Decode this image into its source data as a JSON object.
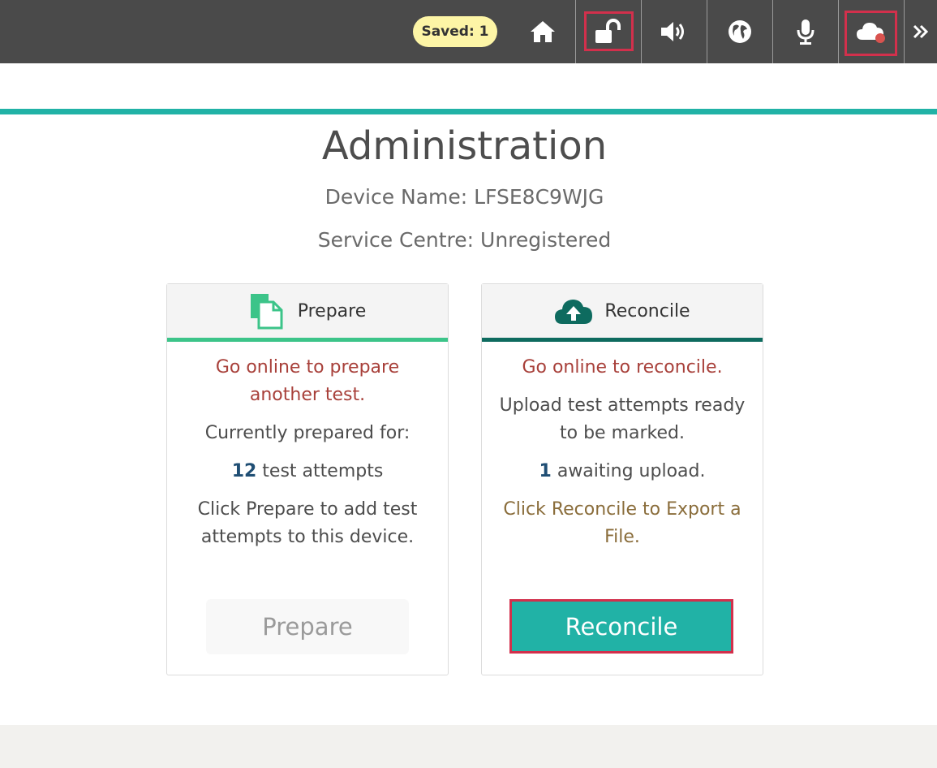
{
  "toolbar": {
    "saved_label": "Saved: 1",
    "icons": [
      "home-icon",
      "unlock-icon",
      "speaker-icon",
      "globe-icon",
      "microphone-icon",
      "cloud-offline-icon",
      "double-chevron-right-icon"
    ]
  },
  "colors": {
    "accent_teal": "#21b2a6",
    "dark_teal": "#0e6b5f",
    "green": "#3cc489",
    "highlight_red": "#d2304c",
    "warning_red": "#a8403a",
    "olive_text": "#8a6d3b",
    "badge_yellow": "#fdf5a6"
  },
  "page": {
    "title": "Administration",
    "device_name": "Device Name: LFSE8C9WJG",
    "service_centre_label": "Service Centre:",
    "service_centre_value": "Unregistered"
  },
  "prepare_card": {
    "title": "Prepare",
    "warning": "Go online to prepare another test.",
    "prepared_for": "Currently prepared for:",
    "count": "12",
    "count_suffix": " test attempts",
    "instruction": "Click Prepare to add test attempts to this device.",
    "button": "Prepare"
  },
  "reconcile_card": {
    "title": "Reconcile",
    "warning": "Go online to reconcile.",
    "description": "Upload test attempts ready to be marked.",
    "count": "1",
    "count_suffix": " awaiting upload.",
    "instruction": "Click Reconcile to Export a File.",
    "button": "Reconcile"
  }
}
